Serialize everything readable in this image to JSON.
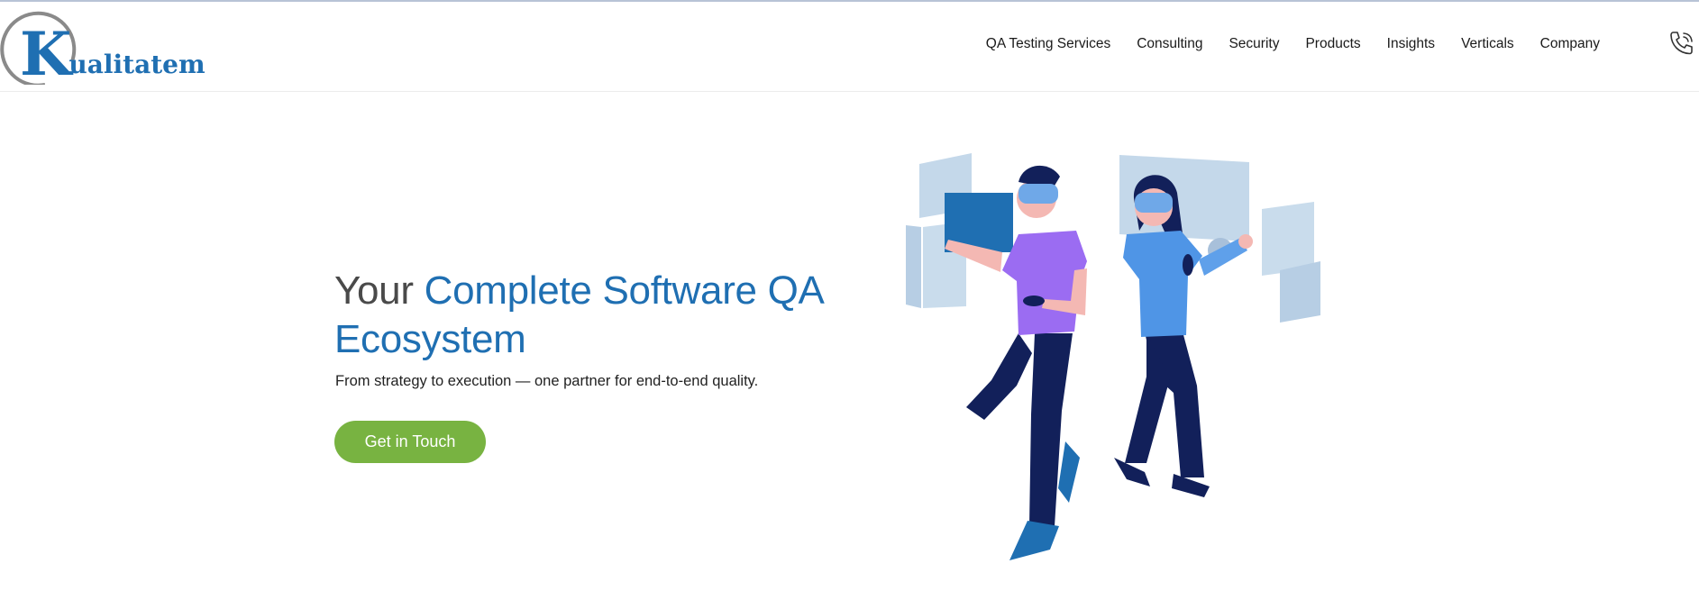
{
  "brand": {
    "logo_letter": "K",
    "logo_rest": "ualitatem",
    "color": "#1f6fb2"
  },
  "nav": {
    "items": [
      "QA Testing Services",
      "Consulting",
      "Security",
      "Products",
      "Insights",
      "Verticals",
      "Company"
    ],
    "phone_icon": "phone-icon"
  },
  "hero": {
    "title_lead": "Your",
    "title_rest": "Complete Software QA Ecosystem",
    "subtitle": "From strategy to execution — one partner for end-to-end quality.",
    "cta_label": "Get in Touch",
    "cta_color": "#78b341",
    "accent_color": "#1f6fb2"
  },
  "illustration": "vr-users-illustration"
}
